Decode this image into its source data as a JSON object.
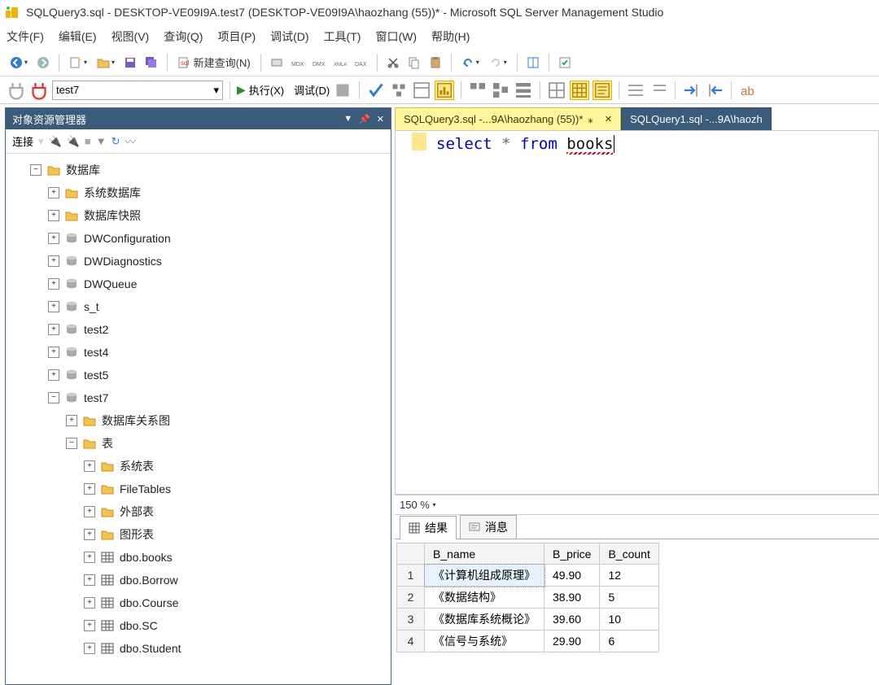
{
  "window": {
    "title": "SQLQuery3.sql - DESKTOP-VE09I9A.test7 (DESKTOP-VE09I9A\\haozhang (55))* - Microsoft SQL Server Management Studio"
  },
  "menu": {
    "file": "文件(F)",
    "edit": "编辑(E)",
    "view": "视图(V)",
    "query": "查询(Q)",
    "project": "项目(P)",
    "debug": "调试(D)",
    "tools": "工具(T)",
    "window": "窗口(W)",
    "help": "帮助(H)"
  },
  "toolbar": {
    "new_query": "新建查询(N)"
  },
  "toolbar2": {
    "db": "test7",
    "execute": "执行(X)",
    "debug": "调试(D)"
  },
  "explorer": {
    "title": "对象资源管理器",
    "connect": "连接",
    "root": "数据库",
    "sysdb": "系统数据库",
    "snap": "数据库快照",
    "dbs": [
      "DWConfiguration",
      "DWDiagnostics",
      "DWQueue",
      "s_t",
      "test2",
      "test4",
      "test5",
      "test7"
    ],
    "test7": {
      "rel": "数据库关系图",
      "tables": "表",
      "systbl": "系统表",
      "filetbl": "FileTables",
      "exttbl": "外部表",
      "graphtbl": "图形表",
      "items": [
        "dbo.books",
        "dbo.Borrow",
        "dbo.Course",
        "dbo.SC",
        "dbo.Student"
      ]
    }
  },
  "tabs": {
    "active": "SQLQuery3.sql -...9A\\haozhang (55))*",
    "inactive": "SQLQuery1.sql -...9A\\haozh"
  },
  "code": {
    "select": "select",
    "star": "*",
    "from": "from",
    "ident": "books"
  },
  "zoom": "150 %",
  "results": {
    "tab1": "结果",
    "tab2": "消息",
    "cols": [
      "B_name",
      "B_price",
      "B_count"
    ],
    "rows": [
      {
        "n": "1",
        "name": "《计算机组成原理》",
        "price": "49.90",
        "count": "12"
      },
      {
        "n": "2",
        "name": "《数据结构》",
        "price": "38.90",
        "count": "5"
      },
      {
        "n": "3",
        "name": "《数据库系统概论》",
        "price": "39.60",
        "count": "10"
      },
      {
        "n": "4",
        "name": "《信号与系统》",
        "price": "29.90",
        "count": "6"
      }
    ]
  }
}
